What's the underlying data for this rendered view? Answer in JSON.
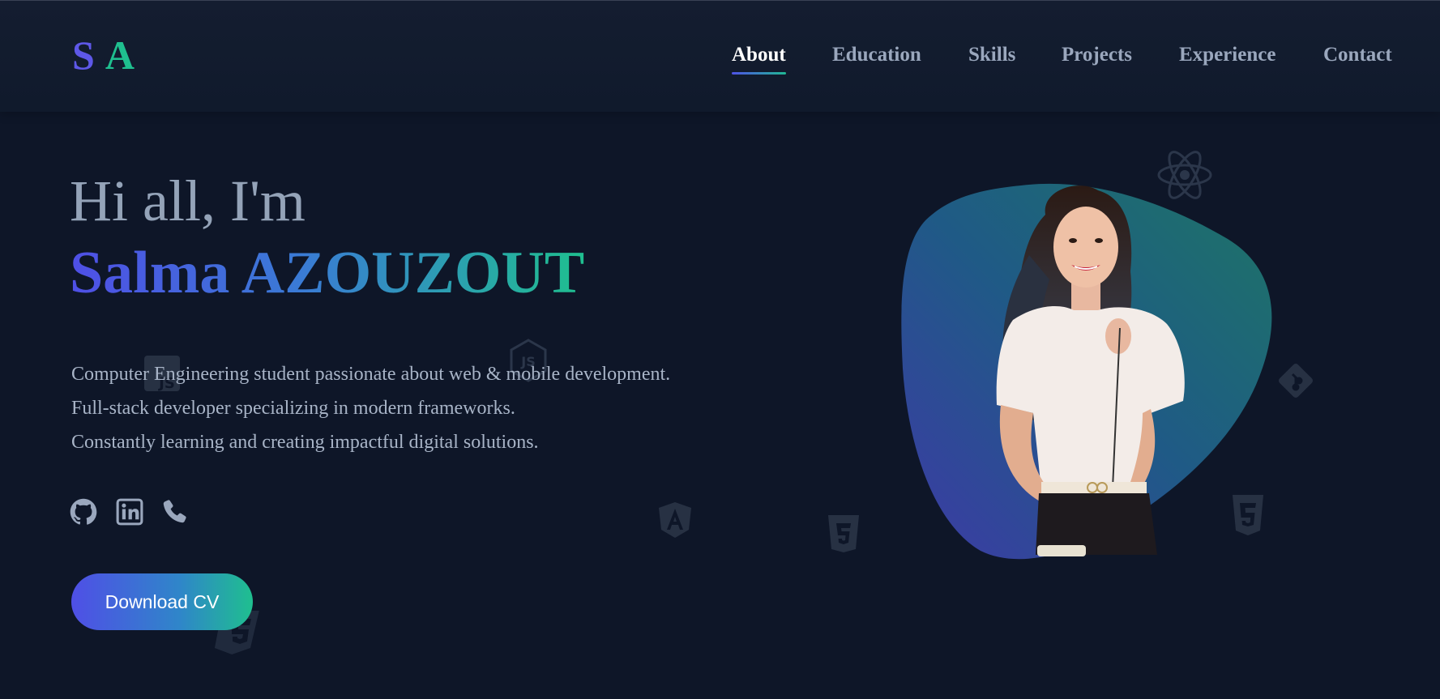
{
  "nav": {
    "logo_s": "S",
    "logo_a": "A",
    "items": [
      {
        "label": "About",
        "active": true
      },
      {
        "label": "Education",
        "active": false
      },
      {
        "label": "Skills",
        "active": false
      },
      {
        "label": "Projects",
        "active": false
      },
      {
        "label": "Experience",
        "active": false
      },
      {
        "label": "Contact",
        "active": false
      }
    ]
  },
  "hero": {
    "greeting": "Hi all, I'm",
    "name": "Salma AZOUZOUT",
    "lines": [
      "Computer Engineering student passionate about web & mobile development.",
      "Full-stack developer specializing in modern frameworks.",
      "Constantly learning and creating impactful digital solutions."
    ],
    "cv_label": "Download CV"
  },
  "social": {
    "icons": [
      "github-icon",
      "linkedin-icon",
      "phone-icon"
    ]
  },
  "colors": {
    "background": "#0e1628",
    "accent_blue": "#4f4fe6",
    "accent_green": "#1fbf8f",
    "nav_text": "#9aa7bd",
    "body_text": "#a8b4c7"
  }
}
